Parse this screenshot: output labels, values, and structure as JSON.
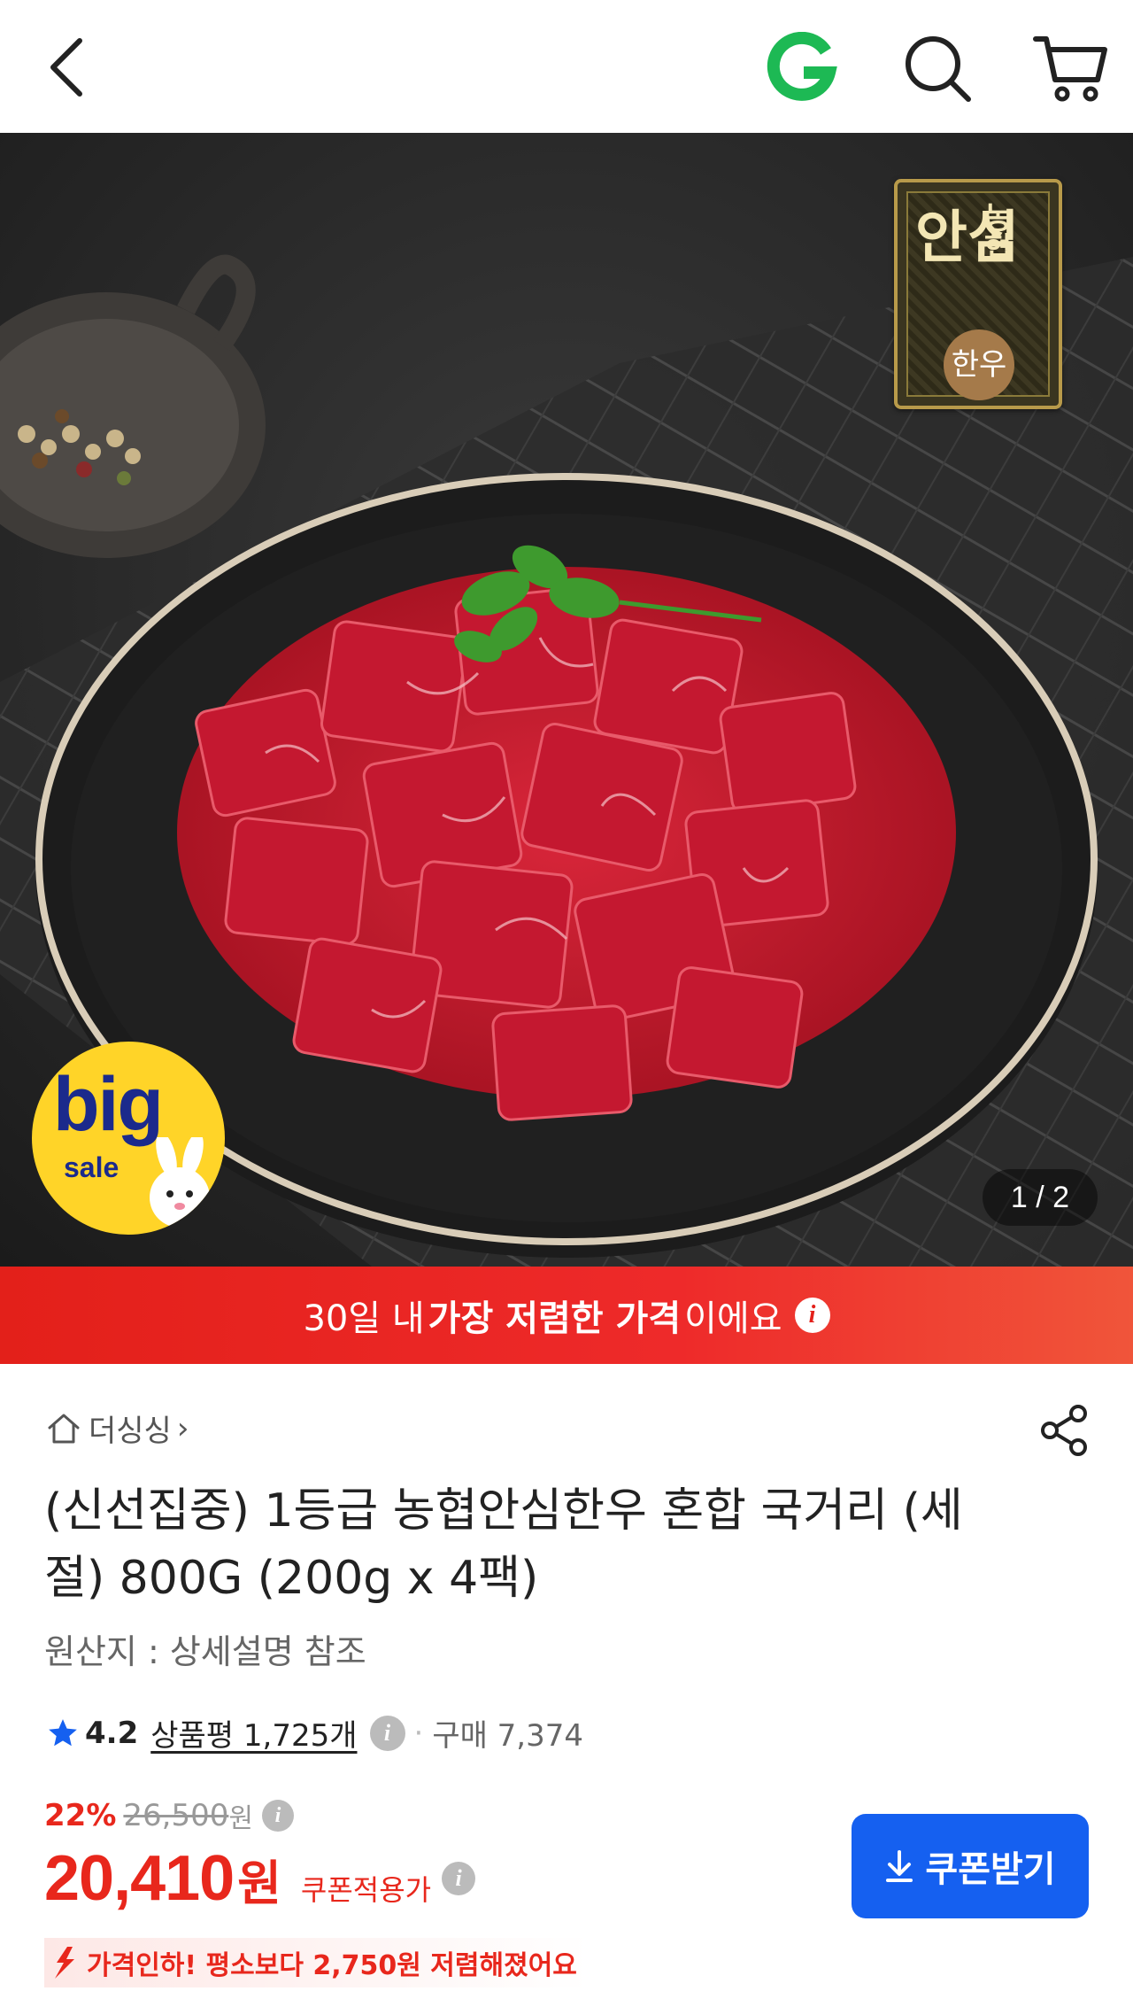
{
  "colors": {
    "brand_green": "#1db954",
    "promo_red": "#e8271c",
    "coupon_blue": "#1560f0",
    "bigsale_yellow": "#ffd428"
  },
  "topbar": {
    "back_icon": "chevron-left-icon",
    "logo_letter": "G",
    "search_icon": "search-icon",
    "cart_icon": "cart-icon"
  },
  "gallery": {
    "counter": "1 / 2",
    "big_sale_line1": "big",
    "big_sale_line2": "sale",
    "badge_brand": "농협",
    "badge_main": "안심",
    "badge_sub": "한우"
  },
  "promo": {
    "prefix": "30일 내 ",
    "bold": "가장 저렴한 가격",
    "suffix": "이에요",
    "info": "i"
  },
  "product": {
    "shop_name": "더싱싱",
    "shop_chevron": "›",
    "title": "(신선집중) 1등급 농협안심한우 혼합 국거리 (세절) 800G (200g x 4팩)",
    "origin": "원산지 : 상세설명 참조",
    "rating": "4.2",
    "reviews": "상품평 1,725개",
    "purchases": "구매 7,374",
    "discount_pct": "22%",
    "original_price": "26,500",
    "original_price_unit": "원",
    "price": "20,410",
    "price_unit": "원",
    "coupon_price_label": "쿠폰적용가",
    "coupon_button": "쿠폰받기",
    "price_drop": "가격인하! 평소보다 2,750원 저렴해졌어요"
  }
}
